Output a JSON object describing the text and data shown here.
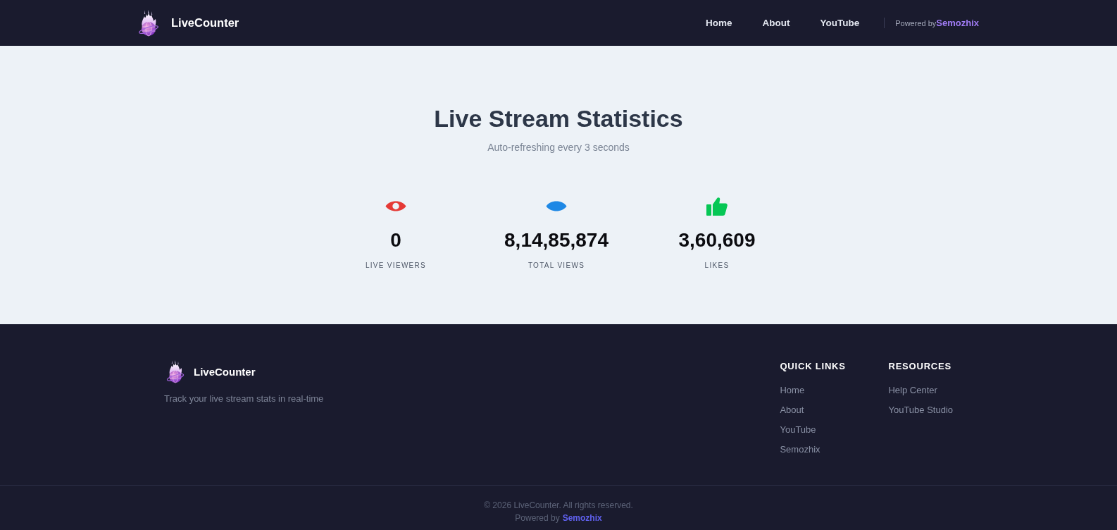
{
  "header": {
    "brand": "LiveCounter",
    "nav": [
      {
        "label": "Home"
      },
      {
        "label": "About"
      },
      {
        "label": "YouTube"
      }
    ],
    "powered_by": {
      "prefix": "Powered by",
      "link": "Semozhix"
    }
  },
  "hero": {
    "title": "Live Stream Statistics",
    "subtitle": "Auto-refreshing every 3 seconds"
  },
  "stats": [
    {
      "kind": "eye",
      "color": "#e53935",
      "value": "0",
      "label": "LIVE VIEWERS"
    },
    {
      "kind": "eye-solid",
      "color": "#1e88e5",
      "value": "8,14,85,874",
      "label": "TOTAL VIEWS"
    },
    {
      "kind": "thumbs-up",
      "color": "#06c755",
      "value": "3,60,609",
      "label": "LIKES"
    }
  ],
  "footer": {
    "brand": "LiveCounter",
    "tagline": "Track your live stream stats in real-time",
    "columns": [
      {
        "heading": "QUICK LINKS",
        "links": [
          "Home",
          "About",
          "YouTube",
          "Semozhix"
        ]
      },
      {
        "heading": "RESOURCES",
        "links": [
          "Help Center",
          "YouTube Studio"
        ]
      }
    ],
    "copyright": "© 2026 LiveCounter. All rights reserved.",
    "powered_by": {
      "prefix": "Powered by",
      "link": "Semozhix"
    }
  }
}
